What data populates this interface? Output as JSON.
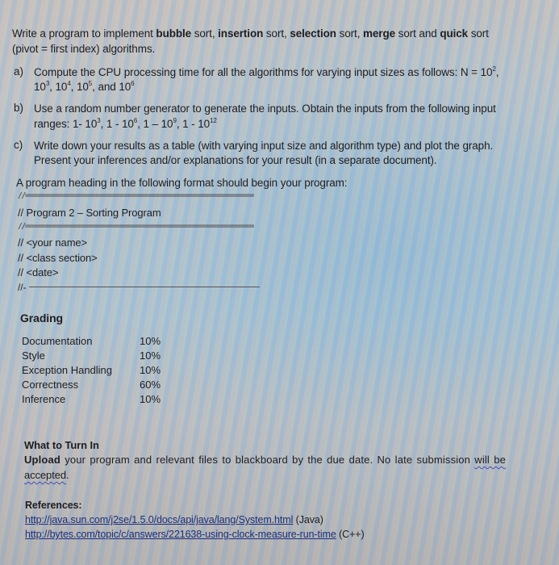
{
  "intro": {
    "prefix": "Write a program to implement ",
    "algo1": "bubble",
    "sep1": " sort, ",
    "algo2": "insertion",
    "sep2": " sort, ",
    "algo3": "selection",
    "sep3": " sort, ",
    "algo4": "merge",
    "sep4": " sort and ",
    "algo5": "quick",
    "suffix": " sort",
    "line2": "(pivot = first index) algorithms."
  },
  "tasks": {
    "a": {
      "marker": "a)",
      "line1": "Compute the CPU processing time for all the algorithms for varying input sizes as follows:  N = 10",
      "line1_sup": "2",
      "line1_end": ",",
      "line2_parts": [
        "10",
        "3",
        ", 10",
        "4",
        ", 10",
        "5",
        ", and 10",
        "6"
      ]
    },
    "b": {
      "marker": "b)",
      "line1": "Use a random number generator to generate the inputs. Obtain the inputs from the following input",
      "line2_parts": [
        "ranges: 1- 10",
        "3",
        ", 1 - 10",
        "6",
        ", 1 – 10",
        "9",
        ", 1 - 10",
        "12"
      ]
    },
    "c": {
      "marker": "c)",
      "line1": "Write down your results as a table (with varying input size and algorithm type) and plot the graph.",
      "line2": "Present your inferences and/or explanations for your result (in a separate document)."
    }
  },
  "heading": {
    "intro": "A program heading in the following format should begin your program:",
    "rule_top": "//================================================================",
    "title": "//   Program 2 – Sorting Program",
    "rule_mid": "//================================================================",
    "name": "// <your name>",
    "section": "// <class section>",
    "date": "// <date>",
    "rule_bottom": "//-"
  },
  "grading": {
    "title": "Grading",
    "rows": [
      {
        "label": "Documentation",
        "value": "10%"
      },
      {
        "label": "Style",
        "value": "10%"
      },
      {
        "label": "Exception Handling",
        "value": "10%"
      },
      {
        "label": "Correctness",
        "value": "60%"
      },
      {
        "label": "Inference",
        "value": "10%"
      }
    ]
  },
  "turn_in": {
    "title": "What to Turn In",
    "bold_lead": "Upload",
    "text": " your program and relevant files to blackboard by the due date. No late submission ",
    "squiggle1": "will be",
    "squiggle2": "accepted",
    "end": "."
  },
  "references": {
    "title": "References:",
    "items": [
      {
        "url": "http://java.sun.com/j2se/1.5.0/docs/api/java/lang/System.html",
        "note": " (Java)"
      },
      {
        "url": "http://bytes.com/topic/c/answers/221638-using-clock-measure-run-time",
        "note": " (C++)"
      }
    ]
  },
  "colors": {
    "text": "#1e1e22",
    "link": "#1b2f7a"
  }
}
